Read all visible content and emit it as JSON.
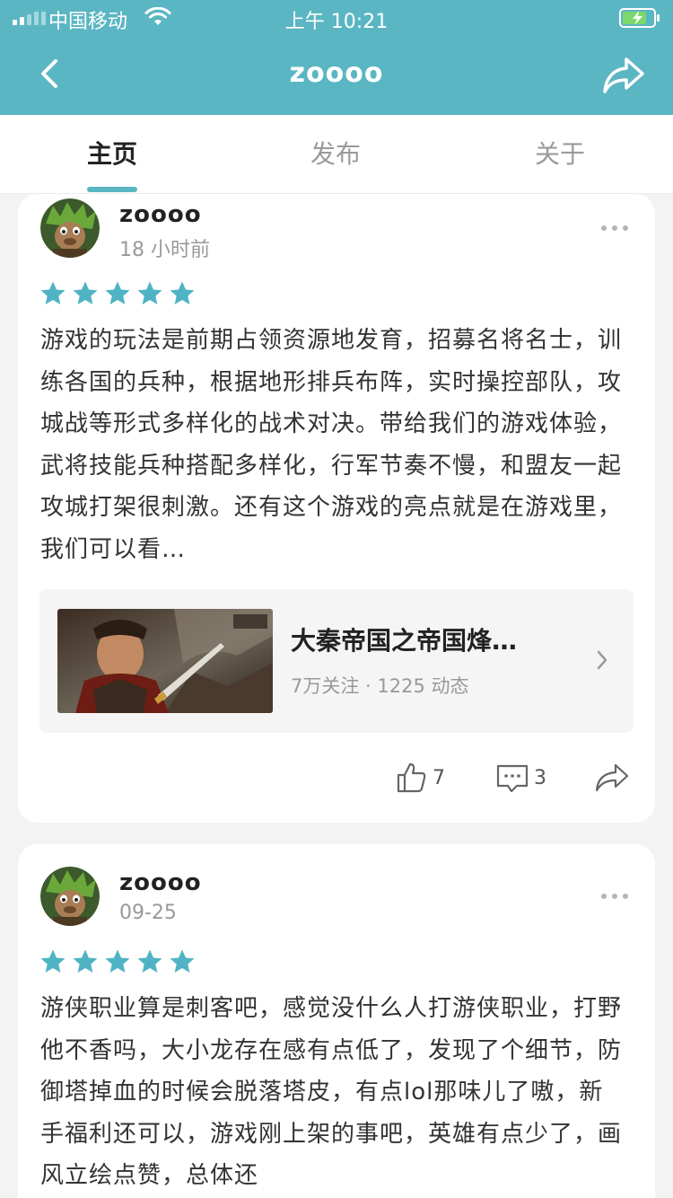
{
  "status_bar": {
    "carrier": "中国移动",
    "time": "上午 10:21"
  },
  "nav": {
    "title": "zoooo",
    "icons": {
      "back": "chevron-left-icon",
      "share": "share-icon"
    }
  },
  "tabs": [
    {
      "label": "主页",
      "active": true
    },
    {
      "label": "发布",
      "active": false
    },
    {
      "label": "关于",
      "active": false
    }
  ],
  "posts": [
    {
      "username": "zoooo",
      "time": "18 小时前",
      "rating": 5,
      "text": "游戏的玩法是前期占领资源地发育，招募名将名士，训练各国的兵种，根据地形排兵布阵，实时操控部队，攻城战等形式多样化的战术对决。带给我们的游戏体验，武将技能兵种搭配多样化，行军节奏不慢，和盟友一起攻城打架很刺激。还有这个游戏的亮点就是在游戏里，我们可以看…",
      "game": {
        "name": "大秦帝国之帝国烽…",
        "meta": "7万关注 · 1225 动态"
      },
      "likes": "7",
      "comments": "3"
    },
    {
      "username": "zoooo",
      "time": "09-25",
      "rating": 5,
      "text": "游侠职业算是刺客吧，感觉没什么人打游侠职业，打野他不香吗，大小龙存在感有点低了，发现了个细节，防御塔掉血的时候会脱落塔皮，有点lol那味儿了嗷，新手福利还可以，游戏刚上架的事吧，英雄有点少了，画风立绘点赞，总体还"
    }
  ],
  "colors": {
    "accent": "#5bb6c3",
    "star": "#4fb3c4",
    "background": "#f3f3f3"
  }
}
